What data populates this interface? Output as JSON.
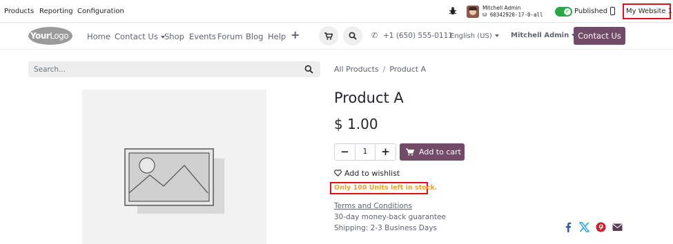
{
  "admin_bar": {
    "menu": [
      "Products",
      "Reporting",
      "Configuration"
    ],
    "user_name": "Mitchell Admin",
    "database": "60342920-17-0-all",
    "published_label": "Published",
    "website_selector": "My Website 1"
  },
  "navbar": {
    "logo_bold": "Your",
    "logo_rest": "Logo",
    "items": [
      "Home",
      "Contact Us",
      "Shop",
      "Events",
      "Forum",
      "Blog",
      "Help"
    ],
    "phone": "+1 (650) 555-0111",
    "language": "English (US)",
    "user": "Mitchell Admin",
    "contact_button": "Contact Us"
  },
  "search": {
    "placeholder": "Search..."
  },
  "breadcrumb": {
    "parent": "All Products",
    "separator": "/",
    "current": "Product A"
  },
  "product": {
    "name": "Product A",
    "price": "$ 1.00",
    "quantity": "1",
    "add_to_cart": "Add to cart",
    "wishlist": "Add to wishlist",
    "stock_message": "Only 100 Units left in stock.",
    "terms": "Terms and Conditions",
    "guarantee": "30-day money-back guarantee",
    "shipping": "Shipping: 2-3 Business Days"
  },
  "colors": {
    "brand": "#714b67",
    "published_toggle": "#28a745",
    "stock_warning": "#f0a030",
    "highlight_border": "#e0101b"
  },
  "icons": [
    "bug-icon",
    "phone-icon",
    "cart-icon",
    "search-icon",
    "heart-icon",
    "facebook-icon",
    "x-icon",
    "pinterest-icon",
    "envelope-icon"
  ]
}
